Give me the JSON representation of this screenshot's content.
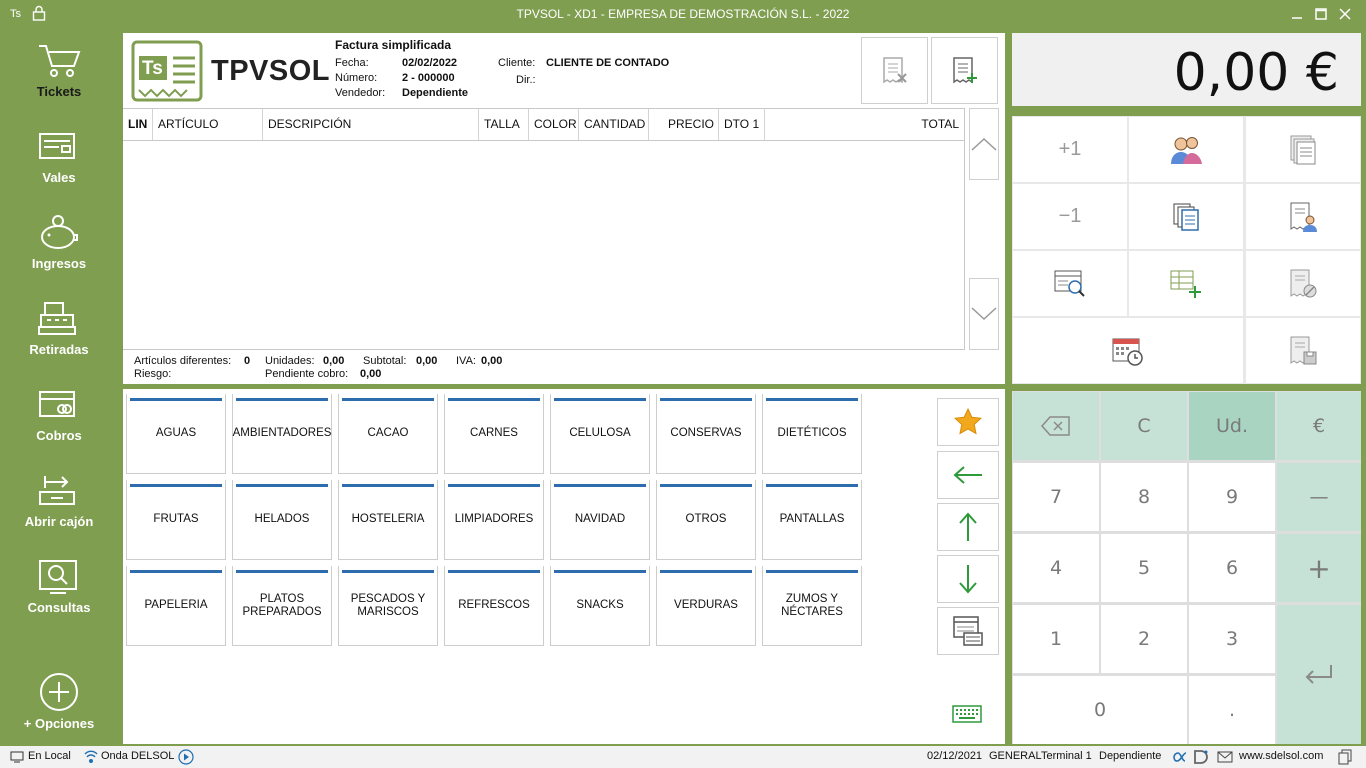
{
  "window": {
    "badge": "Ts",
    "title": "TPVSOL - XD1 - EMPRESA DE DEMOSTRACIÓN S.L. - 2022"
  },
  "sidebar": {
    "items": [
      {
        "label": "Tickets",
        "icon": "cart-icon"
      },
      {
        "label": "Vales",
        "icon": "voucher-icon"
      },
      {
        "label": "Ingresos",
        "icon": "piggy-bank-icon"
      },
      {
        "label": "Retiradas",
        "icon": "cash-register-icon"
      },
      {
        "label": "Cobros",
        "icon": "card-payment-icon"
      },
      {
        "label": "Abrir cajón",
        "icon": "open-drawer-icon"
      },
      {
        "label": "Consultas",
        "icon": "search-screen-icon"
      },
      {
        "label": "+ Opciones",
        "icon": "plus-circle-icon"
      }
    ]
  },
  "header": {
    "brand": "TPVSOL",
    "logo_letters": "Ts",
    "doc_title": "Factura simplificada",
    "fecha_label": "Fecha:",
    "fecha": "02/02/2022",
    "numero_label": "Número:",
    "numero": "2 - 000000",
    "vendedor_label": "Vendedor:",
    "vendedor": "Dependiente",
    "cliente_label": "Cliente:",
    "cliente": "CLIENTE DE CONTADO",
    "dir_label": "Dir.:"
  },
  "grid": {
    "columns": [
      "LIN",
      "ARTÍCULO",
      "DESCRIPCIÓN",
      "TALLA",
      "COLOR",
      "CANTIDAD",
      "PRECIO",
      "DTO 1",
      "TOTAL"
    ]
  },
  "totals": {
    "articulos_label": "Artículos diferentes:",
    "articulos": "0",
    "unidades_label": "Unidades:",
    "unidades": "0,00",
    "subtotal_label": "Subtotal:",
    "subtotal": "0,00",
    "iva_label": "IVA:",
    "iva": "0,00",
    "riesgo_label": "Riesgo:",
    "pendiente_label": "Pendiente cobro:",
    "pendiente": "0,00"
  },
  "categories": [
    "AGUAS",
    "AMBIENTADORES",
    "CACAO",
    "CARNES",
    "CELULOSA",
    "CONSERVAS",
    "DIETÉTICOS",
    "FRUTAS",
    "HELADOS",
    "HOSTELERIA",
    "LIMPIADORES",
    "NAVIDAD",
    "OTROS",
    "PANTALLAS",
    "PAPELERIA",
    "PLATOS PREPARADOS",
    "PESCADOS Y MARISCOS",
    "REFRESCOS",
    "SNACKS",
    "VERDURAS",
    "ZUMOS Y NÉCTARES"
  ],
  "amount": "0,00 €",
  "functions": {
    "plus_one": "+1",
    "minus_one": "−1"
  },
  "keypad": {
    "backspace_icon": "backspace-icon",
    "clear": "C",
    "units": "Ud.",
    "euro": "€",
    "k7": "7",
    "k8": "8",
    "k9": "9",
    "minus": "—",
    "k4": "4",
    "k5": "5",
    "k6": "6",
    "plus": "+",
    "k1": "1",
    "k2": "2",
    "k3": "3",
    "enter_icon": "enter-icon",
    "k0": "0",
    "dot": "."
  },
  "status": {
    "local": "En Local",
    "radio": "Onda DELSOL",
    "date": "02/12/2021",
    "profile": "GENERAL",
    "terminal": "Terminal 1",
    "user": "Dependiente",
    "web": "www.sdelsol.com"
  },
  "colors": {
    "green": "#7f9e50",
    "blue": "#2e6dad",
    "mint": "#c6e2d6",
    "mint_dark": "#a9d4c2"
  }
}
